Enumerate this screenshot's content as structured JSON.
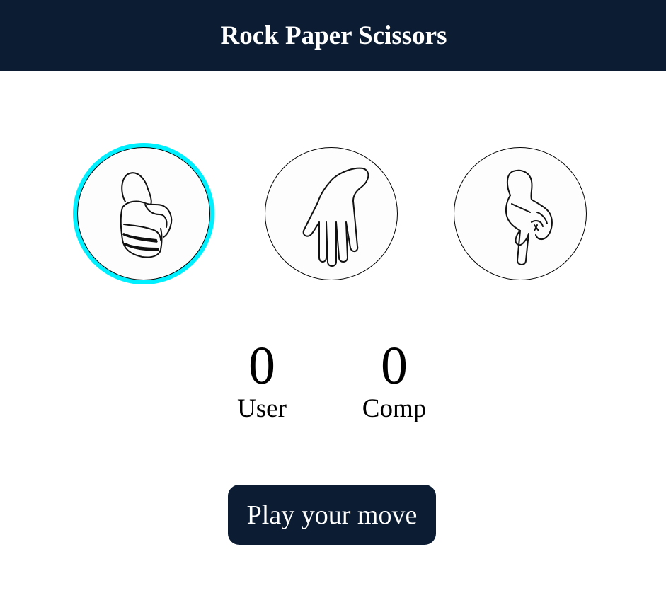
{
  "header": {
    "title": "Rock Paper Scissors"
  },
  "choices": [
    {
      "id": "rock",
      "icon": "rock-hand-icon",
      "selected": true
    },
    {
      "id": "paper",
      "icon": "paper-hand-icon",
      "selected": false
    },
    {
      "id": "scissors",
      "icon": "scissors-hand-icon",
      "selected": false
    }
  ],
  "scores": {
    "user": {
      "value": "0",
      "label": "User"
    },
    "comp": {
      "value": "0",
      "label": "Comp"
    }
  },
  "play_button": {
    "label": "Play your move"
  },
  "colors": {
    "header_bg": "#0b1c33",
    "selected_ring": "#00f0ff",
    "button_bg": "#0b1c33"
  }
}
